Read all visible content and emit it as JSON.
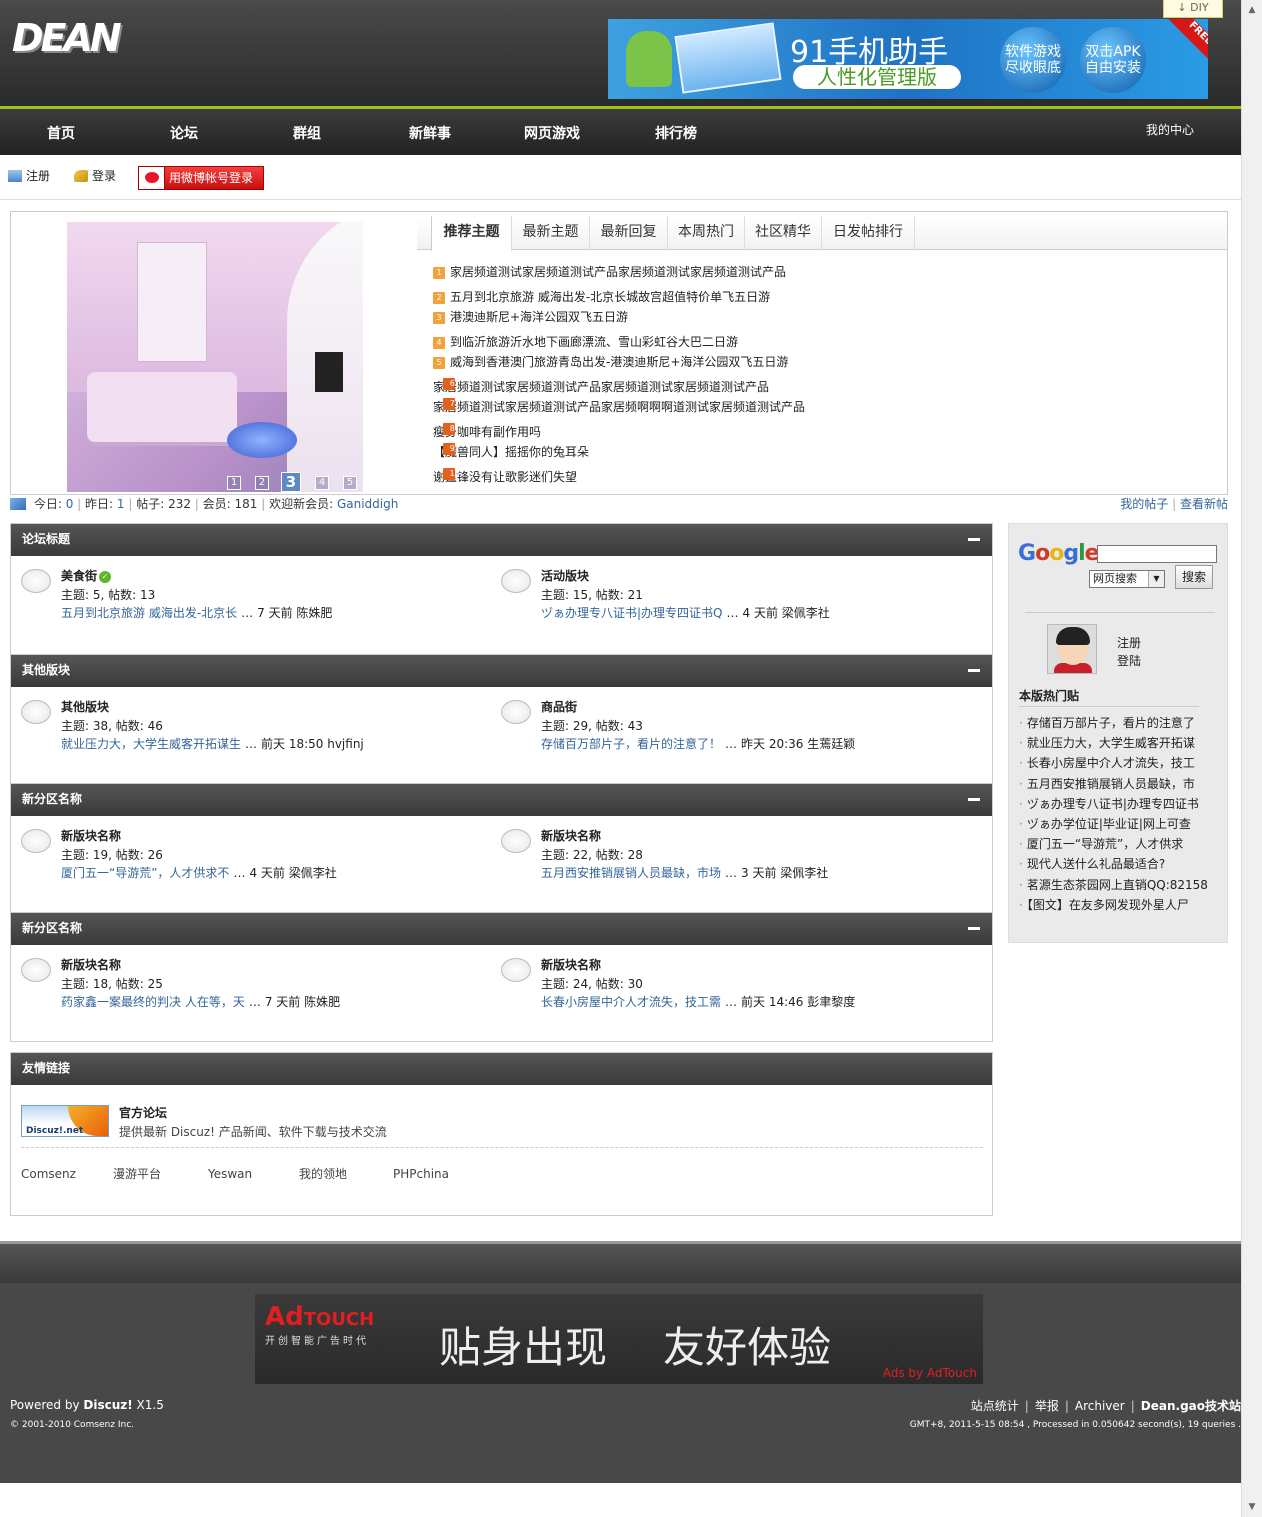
{
  "header": {
    "logo": "DEAN",
    "diy_label": "DIY",
    "banner": {
      "title": "91手机助手",
      "subtitle": "人性化管理版",
      "circle1": "软件游戏尽收眼底",
      "circle2": "双击APK自由安装",
      "badge": "FREE"
    }
  },
  "nav": {
    "items": [
      "首页",
      "论坛",
      "群组",
      "新鲜事",
      "网页游戏",
      "排行榜"
    ],
    "my_center": "我的中心"
  },
  "userbar": {
    "register": "注册",
    "login": "登录",
    "weibo_login": "用微博帐号登录"
  },
  "slideshow": {
    "pages": [
      "1",
      "2",
      "3",
      "4",
      "5"
    ],
    "active_page": "3"
  },
  "tabs": [
    "推荐主题",
    "最新主题",
    "最新回复",
    "本周热门",
    "社区精华",
    "日发帖排行"
  ],
  "topics": [
    {
      "n": "1",
      "title": "家居频道测试家居频道测试产品家居频道测试家居频道测试产品"
    },
    {
      "n": "2",
      "title": "五月到北京旅游  威海出发-北京长城故宫超值特价单飞五日游"
    },
    {
      "n": "3",
      "title": "港澳迪斯尼+海洋公园双飞五日游"
    },
    {
      "n": "4",
      "title": "到临沂旅游沂水地下画廊漂流、雪山彩虹谷大巴二日游"
    },
    {
      "n": "5",
      "title": "威海到香港澳门旅游青岛出发-港澳迪斯尼+海洋公园双飞五日游"
    },
    {
      "n": "6",
      "title": "家居频道测试家居频道测试产品家居频道测试家居频道测试产品"
    },
    {
      "n": "7",
      "title": "家居频道测试家居频道测试产品家居频啊啊啊道测试家居频道测试产品"
    },
    {
      "n": "8",
      "title": "瘦身咖啡有副作用吗"
    },
    {
      "n": "9",
      "title": "【魔兽同人】摇摇你的兔耳朵"
    },
    {
      "n": "10",
      "title": "谢霆锋没有让歌影迷们失望"
    }
  ],
  "stats": {
    "today_label": "今日: ",
    "today": "0",
    "yesterday_label": "昨日: ",
    "yesterday": "1",
    "posts_label": "帖子: ",
    "posts": "232",
    "members_label": "会员: ",
    "members": "181",
    "welcome_label": "欢迎新会员: ",
    "new_member": "Ganiddigh",
    "my_posts": "我的帖子",
    "view_new": "查看新帖"
  },
  "groups": [
    {
      "title": "论坛标题",
      "forums": [
        {
          "name": "美食街",
          "counts": "主题: 5, 帖数: 13",
          "last_title": "五月到北京旅游  威海出发-北京长",
          "last_meta": "7 天前  陈姝肥",
          "verified": true
        },
        {
          "name": "活动版块",
          "counts": "主题: 15, 帖数: 21",
          "last_title": "ヅぁ办理专八证书|办理专四证书Q",
          "last_meta": "4 天前  梁佩李社"
        }
      ]
    },
    {
      "title": "其他版块",
      "forums": [
        {
          "name": "其他版块",
          "counts": "主题: 38, 帖数: 46",
          "last_title": "就业压力大，大学生威客开拓谋生",
          "last_meta": "前天 18:50  hvjfinj"
        },
        {
          "name": "商品街",
          "counts": "主题: 29, 帖数: 43",
          "last_title": "存储百万部片子，看片的注意了！",
          "last_meta": "昨天 20:36  生蔫廷颖"
        }
      ]
    },
    {
      "title": "新分区名称",
      "forums": [
        {
          "name": "新版块名称",
          "counts": "主题: 19, 帖数: 26",
          "last_title": "厦门五一“导游荒”，人才供求不",
          "last_meta": "4 天前  梁佩李社"
        },
        {
          "name": "新版块名称",
          "counts": "主题: 22, 帖数: 28",
          "last_title": "五月西安推销展销人员最缺，市场",
          "last_meta": "3 天前  梁佩李社"
        }
      ]
    },
    {
      "title": "新分区名称",
      "forums": [
        {
          "name": "新版块名称",
          "counts": "主题: 18, 帖数: 25",
          "last_title": "药家鑫一案最终的判决 人在等，天",
          "last_meta": "7 天前  陈姝肥"
        },
        {
          "name": "新版块名称",
          "counts": "主题: 24, 帖数: 30",
          "last_title": "长春小房屋中介人才流失，技工需",
          "last_meta": "前天 14:46  彭聿黎度"
        }
      ]
    }
  ],
  "ellipsis": "…",
  "friend_links": {
    "title": "友情链接",
    "official_logo_text": "Discuz!.net",
    "official_name": "官方论坛",
    "official_desc": "提供最新 Discuz! 产品新闻、软件下载与技术交流",
    "links": [
      "Comsenz",
      "漫游平台",
      "Yeswan",
      "我的领地",
      "PHPchina"
    ]
  },
  "sidebar": {
    "google": [
      "G",
      "o",
      "o",
      "g",
      "l",
      "e"
    ],
    "search_option": "网页搜索",
    "search_button": "搜索",
    "register": "注册",
    "login": "登陆",
    "hot_title": "本版热门贴",
    "hot_posts": [
      "存储百万部片子，看片的注意了",
      "就业压力大，大学生威客开拓谋",
      "长春小房屋中介人才流失，技工",
      "五月西安推销展销人员最缺，市",
      "ヅぁ办理专八证书|办理专四证书",
      "ヅぁ办学位证|毕业证|网上可查",
      "厦门五一“导游荒”，人才供求",
      "现代人送什么礼品最适合?",
      "茗源生态茶园网上直销QQ:82158",
      "【图文】在友多网发现外星人尸"
    ]
  },
  "ad": {
    "brand_red": "Ad",
    "brand_white": "TOUCH",
    "tagline": "开创智能广告时代",
    "slogan1": "贴身出现",
    "slogan2": "友好体验",
    "by": "Ads by AdTouch"
  },
  "footer": {
    "powered_prefix": "Powered by ",
    "powered_brand": "Discuz!",
    "powered_version": " X1.5",
    "copyright": "© 2001-2010 Comsenz Inc.",
    "links": [
      "站点统计",
      "举报",
      "Archiver"
    ],
    "site_name": "Dean.gao技术站",
    "debug": "GMT+8, 2011-5-15 08:54 , Processed in 0.050642 second(s), 19 queries ."
  },
  "colors": {
    "accent_green": "#9ac21a",
    "link_blue": "#336699",
    "header_dark": "#3a3a3a"
  }
}
